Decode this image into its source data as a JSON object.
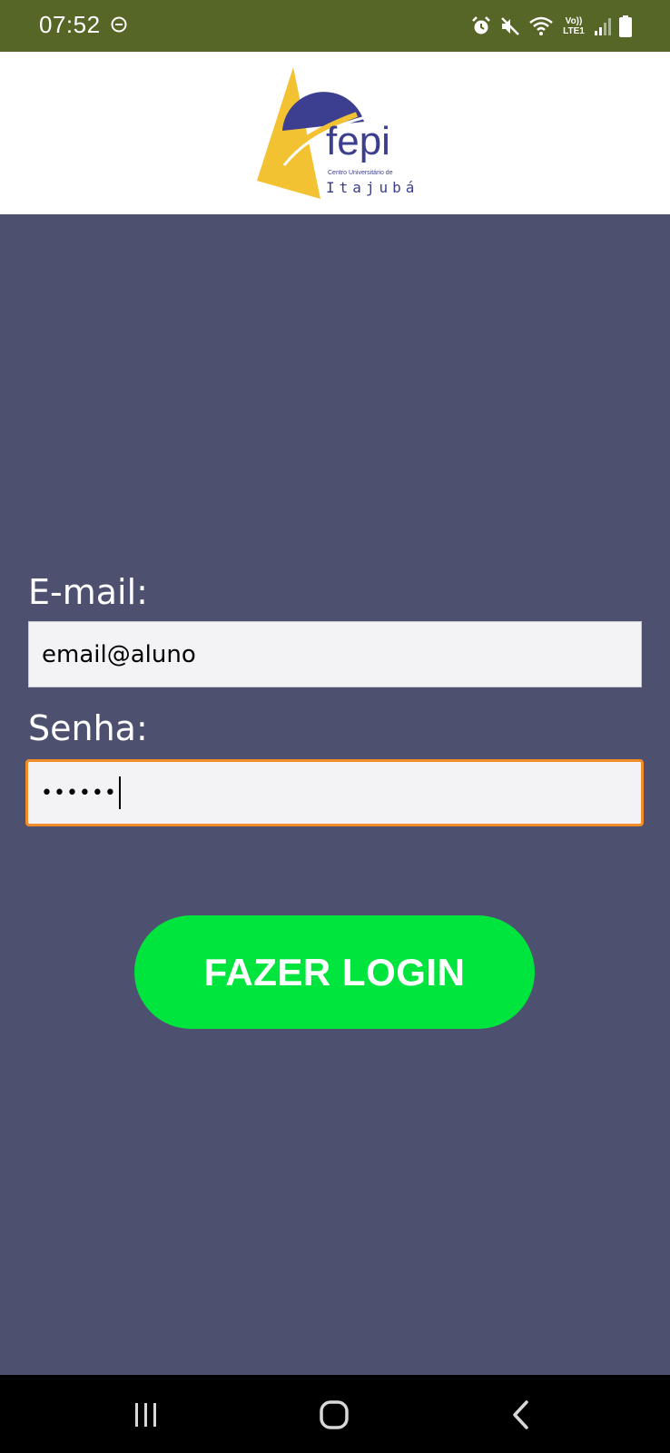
{
  "status_bar": {
    "time": "07:52",
    "lte_line1": "Vo))",
    "lte_line2": "LTE1",
    "icons": [
      "do-not-disturb-icon",
      "alarm-icon",
      "mute-icon",
      "wifi-icon",
      "signal-icon",
      "battery-icon"
    ]
  },
  "header": {
    "logo_name": "fepi",
    "logo_subtitle": "Centro Universitário de",
    "logo_city": "Itajubá"
  },
  "form": {
    "email_label": "E-mail:",
    "email_value": "email@aluno",
    "password_label": "Senha:",
    "password_value": "••••••",
    "login_button": "FAZER LOGIN"
  },
  "colors": {
    "status_bar": "#556627",
    "background": "#4e5070",
    "button": "#00e43e",
    "focus_border": "#f28c28",
    "logo_blue": "#3c3f8f",
    "logo_yellow": "#f2c232"
  },
  "nav_bar": {
    "icons": [
      "recents-icon",
      "home-icon",
      "back-icon"
    ]
  }
}
